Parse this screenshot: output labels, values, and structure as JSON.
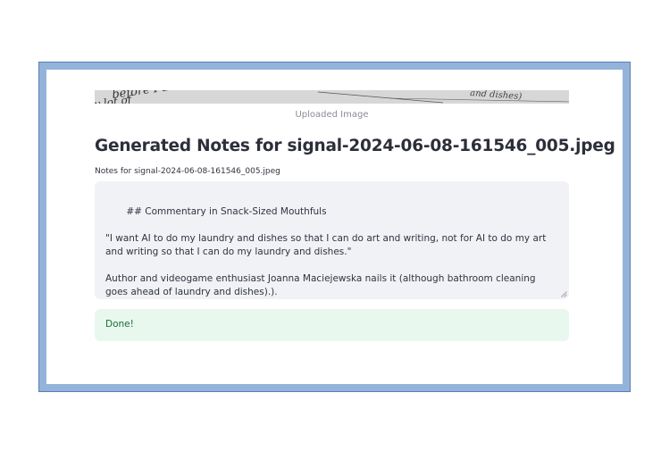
{
  "uploaded_image": {
    "caption": "Uploaded Image",
    "snippet_left": "y lot of",
    "snippet_left_top": "before I deserve",
    "snippet_right": "and dishes)"
  },
  "notes": {
    "title": "Generated Notes for signal-2024-06-08-161546_005.jpeg",
    "field_label": "Notes for signal-2024-06-08-161546_005.jpeg",
    "content": " ## Commentary in Snack-Sized Mouthfuls\n\n\"I want AI to do my laundry and dishes so that I can do art and writing, not for AI to do my art and writing so that I can do my laundry and dishes.\"\n\nAuthor and videogame enthusiast Joanna Maciejewska nails it (although bathroom cleaning goes ahead of laundry and dishes).)."
  },
  "status": {
    "message": "Done!",
    "color": "#1d6b3a"
  }
}
